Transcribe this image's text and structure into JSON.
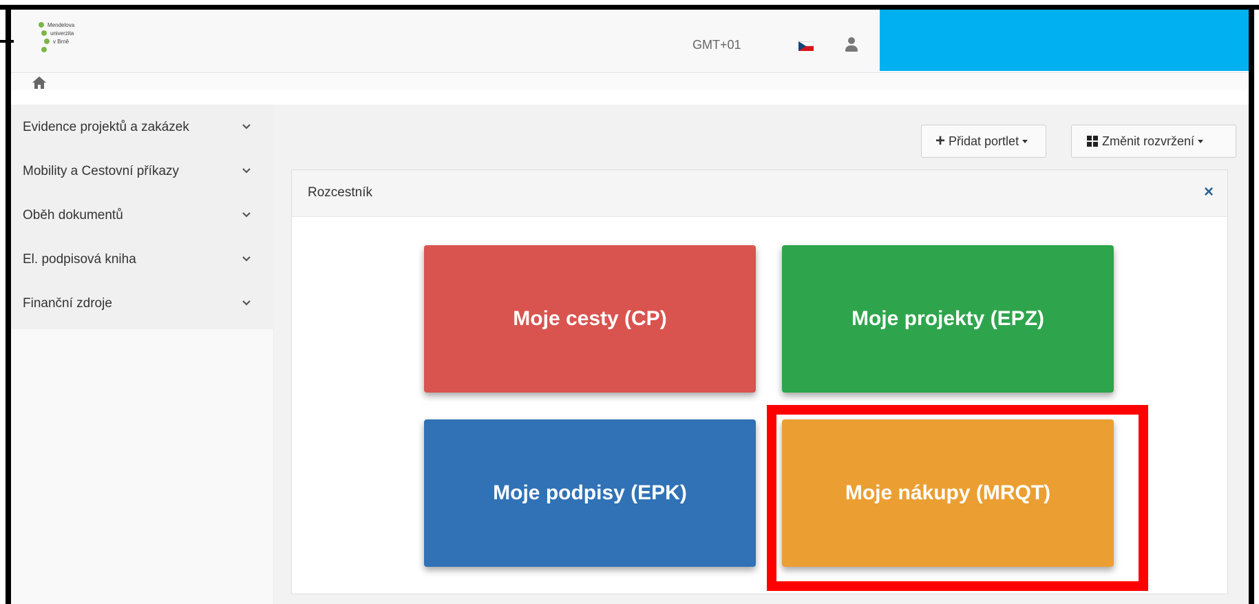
{
  "header": {
    "logo_lines": [
      "Mendelova",
      "univerzita",
      "v Brně",
      ""
    ],
    "timezone": "GMT+01",
    "flag_icon": "czech-flag-icon",
    "user_icon": "user-icon",
    "redaction_color": "#00b0f0"
  },
  "breadcrumb": {
    "home_icon": "home-icon"
  },
  "sidebar": {
    "items": [
      {
        "label": "Evidence projektů a zakázek"
      },
      {
        "label": "Mobility a Cestovní příkazy"
      },
      {
        "label": "Oběh dokumentů"
      },
      {
        "label": "El. podpisová kniha"
      },
      {
        "label": "Finanční zdroje"
      }
    ]
  },
  "toolbar": {
    "add_portlet_label": "Přidat portlet",
    "change_layout_label": "Změnit rozvržení"
  },
  "portlet": {
    "title": "Rozcestník",
    "close_label": "×",
    "tiles": [
      {
        "label": "Moje cesty (CP)",
        "color": "#d9534f"
      },
      {
        "label": "Moje projekty (EPZ)",
        "color": "#2ea54c"
      },
      {
        "label": "Moje podpisy (EPK)",
        "color": "#3072b5"
      },
      {
        "label": "Moje nákupy (MRQT)",
        "color": "#eb9f32"
      }
    ]
  },
  "annotation": {
    "highlight_color": "#ff0000",
    "highlighted_tile": "Moje nákupy (MRQT)"
  }
}
